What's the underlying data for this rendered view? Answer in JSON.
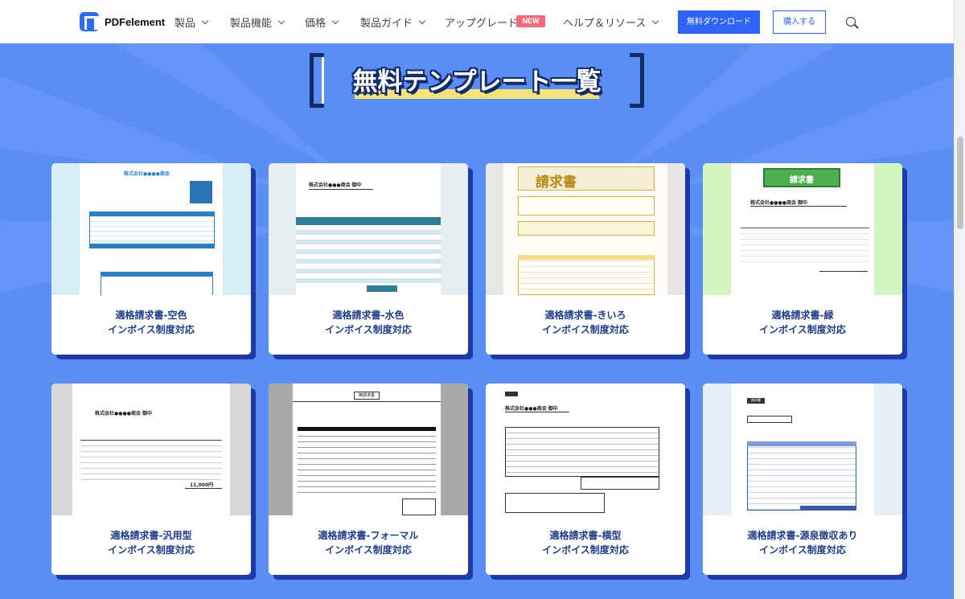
{
  "header": {
    "brand": "PDFelement",
    "nav": [
      {
        "label": "製品",
        "has_dropdown": true
      },
      {
        "label": "製品機能",
        "has_dropdown": true
      },
      {
        "label": "価格",
        "has_dropdown": true
      },
      {
        "label": "製品ガイド",
        "has_dropdown": true
      },
      {
        "label": "アップグレード",
        "has_dropdown": false,
        "badge": "NEW"
      },
      {
        "label": "ヘルプ＆リソース",
        "has_dropdown": true
      }
    ],
    "download_button": "無料ダウンロード",
    "buy_button": "購入する",
    "search_icon": "search-icon"
  },
  "section": {
    "title": "無料テンプレート一覧"
  },
  "templates": [
    {
      "name": "適格請求書-空色",
      "sub": "インボイス制度対応",
      "thumb_title": "株式会社●●●●商会"
    },
    {
      "name": "適格請求書-水色",
      "sub": "インボイス制度対応",
      "thumb_title": "株式会社●●●商会 御中"
    },
    {
      "name": "適格請求書-きいろ",
      "sub": "インボイス制度対応",
      "thumb_title": "請求書"
    },
    {
      "name": "適格請求書-緑",
      "sub": "インボイス制度対応",
      "thumb_title": "請求書"
    },
    {
      "name": "適格請求書-汎用型",
      "sub": "インボイス制度対応",
      "thumb_title": "株式会社●●●●商会 御中"
    },
    {
      "name": "適格請求書-フォーマル",
      "sub": "インボイス制度対応",
      "thumb_title": "御請求書"
    },
    {
      "name": "適格請求書-横型",
      "sub": "インボイス制度対応",
      "thumb_title": "株式会社●●●商会 御中"
    },
    {
      "name": "適格請求書-源泉徴収あり",
      "sub": "インボイス制度対応",
      "thumb_title": "請求書"
    }
  ],
  "colors": {
    "page_bg": "#5b8ef5",
    "card_shadow": "#1f3aa8",
    "label": "#1f3d8a",
    "primary_button": "#2f63f5",
    "badge": "#f26a7b"
  }
}
